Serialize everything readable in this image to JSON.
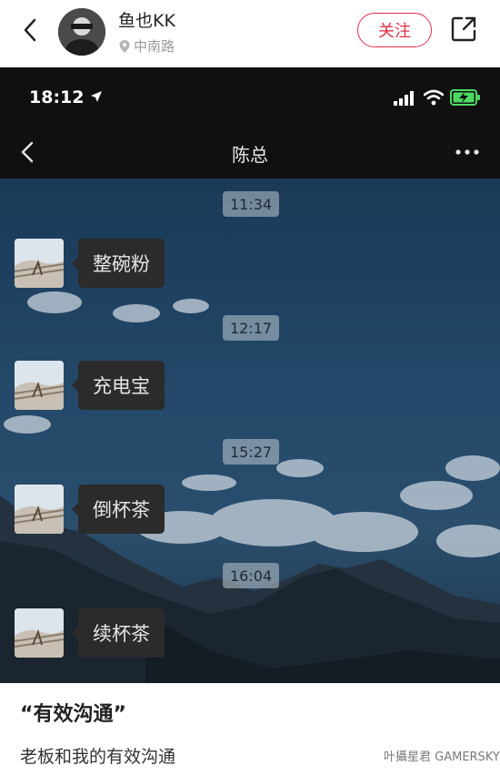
{
  "header": {
    "username": "鱼也KK",
    "location": "中南路",
    "follow_label": "关注"
  },
  "chat": {
    "status_time": "18:12",
    "title": "陈总",
    "messages": [
      {
        "time": "11:34",
        "text": "整碗粉"
      },
      {
        "time": "12:17",
        "text": "充电宝"
      },
      {
        "time": "15:27",
        "text": "倒杯茶"
      },
      {
        "time": "16:04",
        "text": "续杯茶"
      }
    ]
  },
  "post": {
    "title": "“有效沟通”",
    "body": "老板和我的有效沟通"
  },
  "watermark": "叶攝星君 GAMERSKY",
  "colors": {
    "accent": "#e0314b",
    "status_bar": "#101010",
    "bubble": "#2b2b2b",
    "battery": "#4cd964"
  }
}
